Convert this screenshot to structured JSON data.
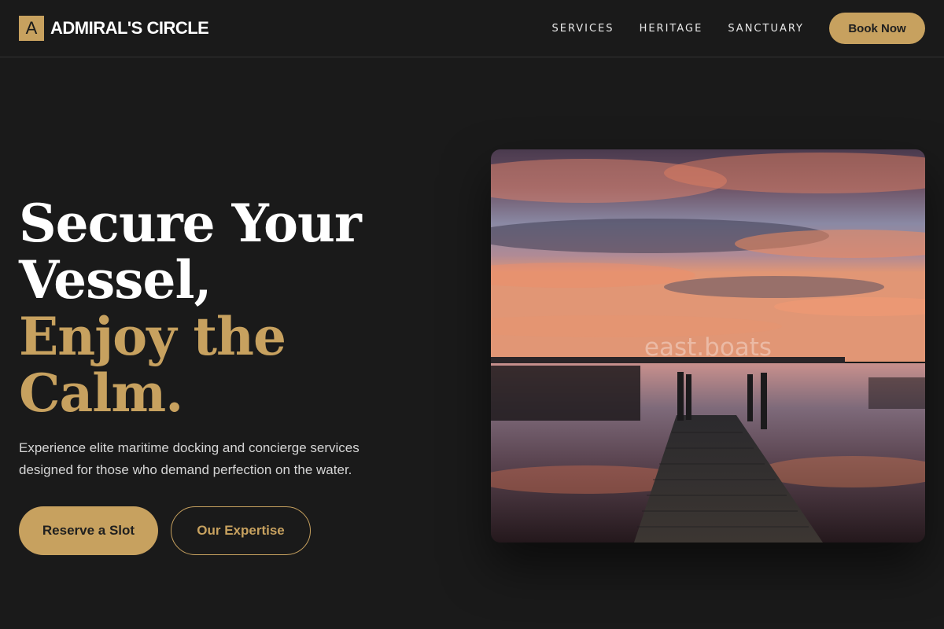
{
  "brand": {
    "logo_letter": "A",
    "name": "ADMIRAL'S CIRCLE"
  },
  "nav": {
    "links": [
      "SERVICES",
      "HERITAGE",
      "SANCTUARY"
    ],
    "book_label": "Book Now"
  },
  "hero": {
    "headline_line1": "Secure Your",
    "headline_line2": "Vessel,",
    "headline_accent": "Enjoy the Calm.",
    "subtext": "Experience elite maritime docking and concierge services designed for those who demand perfection on the water.",
    "primary_cta": "Reserve a Slot",
    "secondary_cta": "Our Expertise"
  },
  "image": {
    "watermark": "east.boats"
  },
  "colors": {
    "background": "#1a1a1a",
    "accent": "#c7a15f",
    "text": "#ffffff"
  }
}
